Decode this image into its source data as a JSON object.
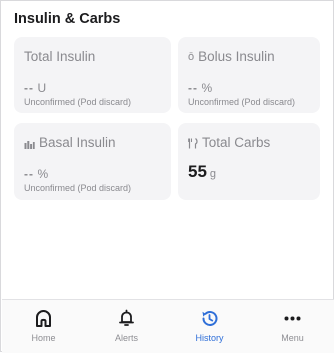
{
  "section": {
    "title": "Insulin & Carbs"
  },
  "cards": {
    "total_insulin": {
      "title": "Total Insulin",
      "value_dashes": "--",
      "unit": "U",
      "subtitle": "Unconfirmed (Pod discard)"
    },
    "bolus_insulin": {
      "icon_glyph": "ō",
      "title": "Bolus Insulin",
      "value_dashes": "--",
      "unit": "%",
      "subtitle": "Unconfirmed (Pod discard)"
    },
    "basal_insulin": {
      "title": "Basal Insulin",
      "value_dashes": "--",
      "unit": "%",
      "subtitle": "Unconfirmed (Pod discard)"
    },
    "total_carbs": {
      "title": "Total Carbs",
      "value": "55",
      "unit": "g"
    }
  },
  "tabbar": {
    "items": [
      {
        "label": "Home",
        "icon": "home-icon"
      },
      {
        "label": "Alerts",
        "icon": "bell-icon"
      },
      {
        "label": "History",
        "icon": "history-icon",
        "active": true
      },
      {
        "label": "Menu",
        "icon": "more-icon"
      }
    ]
  },
  "colors": {
    "accent": "#2f6fd8",
    "card_bg": "#f4f4f6",
    "muted_text": "#8a8a8f",
    "primary_text": "#1c1c1e"
  }
}
